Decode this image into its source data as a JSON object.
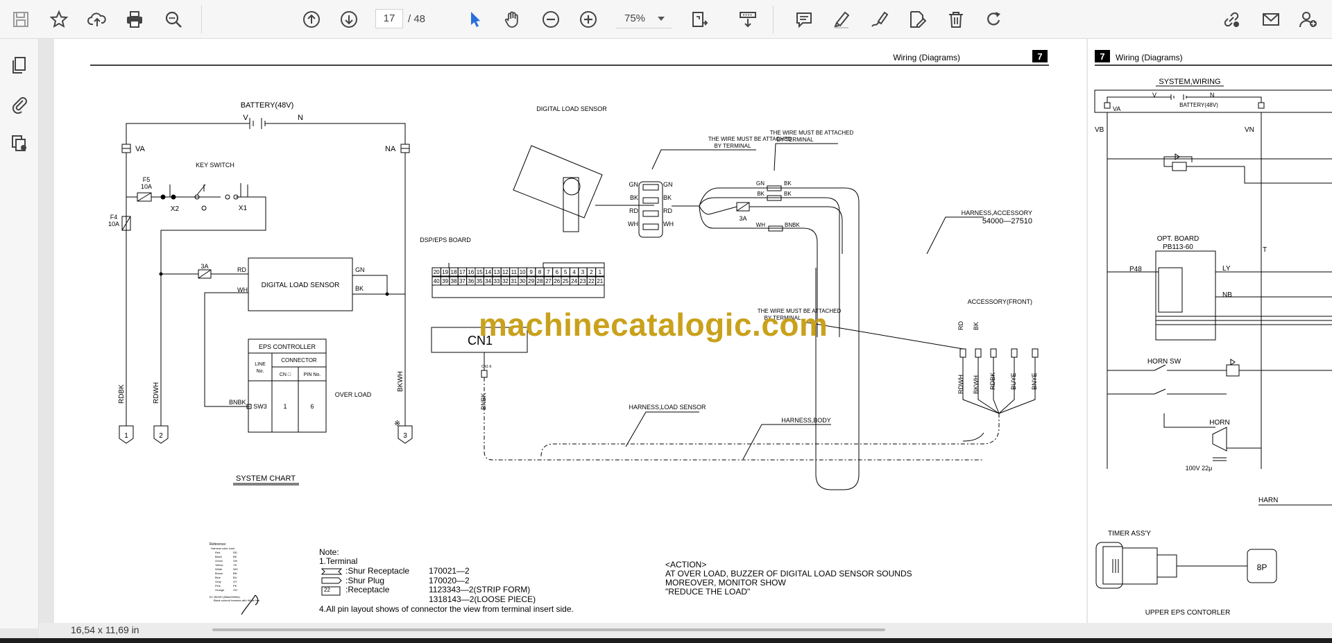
{
  "toolbar": {
    "icons": [
      "save-icon",
      "bookmark-star-icon",
      "upload-cloud-icon",
      "print-icon",
      "find-icon",
      "prev-page-icon",
      "next-page-icon",
      "zoom-out-icon",
      "zoom-in-icon",
      "select-cursor-icon",
      "hand-icon",
      "fit-page-icon",
      "scroll-mode-icon",
      "comment-icon",
      "highlight-icon",
      "draw-icon",
      "fill-sign-icon",
      "delete-icon",
      "rotate-icon",
      "share-link-icon",
      "email-icon",
      "add-user-icon"
    ],
    "page_current": "17",
    "page_total": "/ 48",
    "zoom": "75%"
  },
  "left_rail": {
    "icons": [
      "pages-thumbnail-icon",
      "attachment-icon",
      "layers-icon"
    ]
  },
  "status": {
    "page_size": "16,54 x 11,69 in"
  },
  "watermark": "machinecatalogic.com",
  "page17": {
    "header": "Wiring (Diagrams)",
    "section_no": "7",
    "battery": "BATTERY(48V)",
    "v": "V",
    "n": "N",
    "va": "VA",
    "na": "NA",
    "key_switch": "KEY SWITCH",
    "f5": "F5",
    "f5_rating": "10A",
    "f4": "F4",
    "f4_rating": "10A",
    "x2": "X2",
    "x1": "X1",
    "fuse_3a": "3A",
    "dls_box": "DIGITAL LOAD SENSOR",
    "rd": "RD",
    "wh": "WH",
    "gn": "GN",
    "bk": "BK",
    "eps_controller": "EPS CONTROLLER",
    "line_no_1": "LINE",
    "line_no_2": "No.",
    "connector": "CONNECTOR",
    "cn_no": "CN □",
    "pin_no": "PIN No.",
    "sw3": "SW3",
    "cn_val": "1",
    "pin_val": "6",
    "bnbk": "BNBK",
    "over_load": "OVER LOAD",
    "rdbk": "RDBK",
    "rdwh": "RDWH",
    "bkwh": "BKWH",
    "term1": "1",
    "term2": "2",
    "term3": "3",
    "ref_mark": "※",
    "system_chart": "SYSTEM CHART",
    "dsp_eps_board": "DSP/EPS BOARD",
    "pins_top": [
      "20",
      "19",
      "18",
      "17",
      "16",
      "15",
      "14",
      "13",
      "12",
      "11",
      "10",
      "9",
      "8",
      "7",
      "6",
      "5",
      "4",
      "3",
      "2",
      "1"
    ],
    "pins_bottom": [
      "40",
      "39",
      "38",
      "37",
      "36",
      "35",
      "34",
      "33",
      "32",
      "31",
      "30",
      "29",
      "28",
      "27",
      "26",
      "25",
      "24",
      "23",
      "22",
      "21"
    ],
    "cn1": "CN1",
    "cn1_6": "CN1-6",
    "dls_label": "DIGITAL LOAD SENSOR",
    "wire_terminal_1a": "THE WIRE MUST BE ATTACHED",
    "wire_terminal_1b": "BY TERMINAL",
    "wire_terminal_2a": "THE WIRE MUST BE ATTACHED",
    "wire_terminal_2b": "BY TERMINAL",
    "wire_terminal_3a": "THE WIRE MUST BE ATTACHED",
    "wire_terminal_3b": "BY TERMINAL",
    "harness_accessory": "HARNESS,ACCESSORY",
    "harness_accessory_no": "54000—27510",
    "accessory_front": "ACCESSORY(FRONT)",
    "harness_load_sensor": "HARNESS,LOAD SENSOR",
    "harness_body": "HARNESS,BODY",
    "bnbk2": "BNBK",
    "rdbk2": "RDBK",
    "buye": "BUYE",
    "bnye": "BNYE",
    "note_title": "Note:",
    "note_1": "1.Terminal",
    "note_shur_rec": ":Shur Receptacle",
    "note_shur_rec_no": "170021—2",
    "note_shur_plug": ":Shur Plug",
    "note_shur_plug_no": "170020—2",
    "note_receptacle": ":Receptacle",
    "note_receptacle_no": "1123343—2(STRIP FORM)",
    "note_loose": "1318143—2(LOOSE PIECE)",
    "note_22": "22",
    "note_4": "4.All pin layout shows of connector the view from terminal insert side.",
    "action_title": "<ACTION>",
    "action_1": "AT OVER LOAD, BUZZER OF DIGITAL LOAD SENSOR SOUNDS",
    "action_2": "MOREOVER, MONITOR SHOW",
    "action_3": "\"REDUCE THE LOAD\"",
    "legend_title": "Reference:",
    "legend_sub": "Harness color color",
    "legend_colors": [
      [
        "Red",
        "RD"
      ],
      [
        "Black",
        "BK"
      ],
      [
        "Green",
        "GN"
      ],
      [
        "Yellow",
        "YE"
      ],
      [
        "White",
        "WH"
      ],
      [
        "Brown",
        "BN"
      ],
      [
        "Blue",
        "BU"
      ],
      [
        "Gray",
        "GY"
      ],
      [
        "Pink",
        "PK"
      ],
      [
        "Orange",
        "OG"
      ]
    ],
    "legend_ex1": "Ex: BKWH (Black/White)",
    "legend_ex2": "Black colored harness with White line"
  },
  "page18": {
    "section_no": "7",
    "header": "Wiring (Diagrams)",
    "system_wiring": "SYSTEM,WIRING",
    "v": "V",
    "n": "N",
    "va": "VA",
    "battery": "BATTERY(48V)",
    "vb": "VB",
    "vn": "VN",
    "opt_board": "OPT. BOARD",
    "opt_board_no": "PB113-60",
    "p48": "P48",
    "ly": "LY",
    "nb": "NB",
    "horn_sw": "HORN SW",
    "horn": "HORN",
    "cap": "100V 22μ",
    "harn": "HARN",
    "t": "T",
    "timer_assy": "TIMER ASS'Y",
    "eight_p": "8P",
    "upper_eps": "UPPER EPS CONTORLER"
  }
}
